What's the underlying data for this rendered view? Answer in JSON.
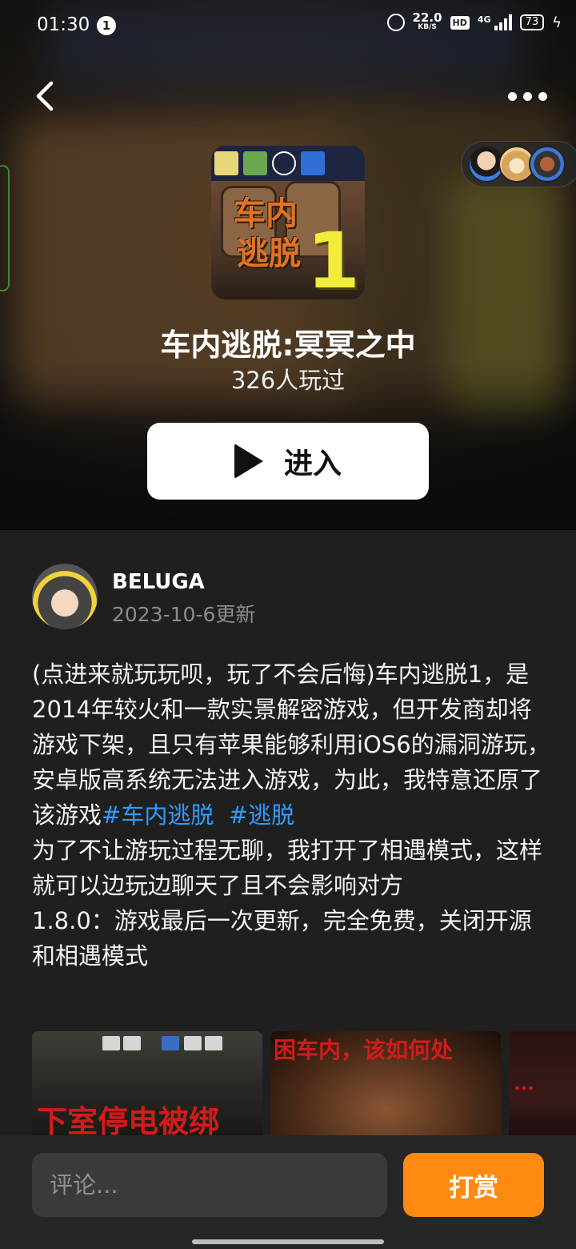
{
  "status_bar": {
    "time": "01:30",
    "notification_count": "1",
    "net_speed": "22.0",
    "net_unit": "KB/S",
    "hd": "HD",
    "network": "4G",
    "battery": "73"
  },
  "game": {
    "title": "车内逃脱:冥冥之中",
    "players": "326人玩过",
    "enter_label": "进入",
    "icon_text_1": "车内",
    "icon_text_2": "逃脱",
    "icon_number": "1"
  },
  "author": {
    "name": "BELUGA",
    "updated": "2023-10-6更新"
  },
  "description": {
    "part1": "(点进来就玩玩呗，玩了不会后悔)车内逃脱1，是2014年较火和一款实景解密游戏，但开发商却将游戏下架，且只有苹果能够利用iOS6的漏洞游玩，安卓版高系统无法进入游戏，为此，我特意还原了该游戏",
    "tag1": "#车内逃脱",
    "tag2": "#逃脱",
    "part2": "为了不让游玩过程无聊，我打开了相遇模式，这样就可以边玩边聊天了且不会影响对方\n1.8.0：游戏最后一次更新，完全免费，关闭开源和相遇模式"
  },
  "screenshots": {
    "shot1_caption": "下室停电被绑",
    "shot2_caption": "困车内，该如何处",
    "shot3_caption": "…"
  },
  "bottom": {
    "comment_placeholder": "评论...",
    "tip_label": "打赏"
  },
  "colors": {
    "accent": "#ff8a11",
    "tag": "#2f9bff",
    "background": "#1f1f1f"
  }
}
